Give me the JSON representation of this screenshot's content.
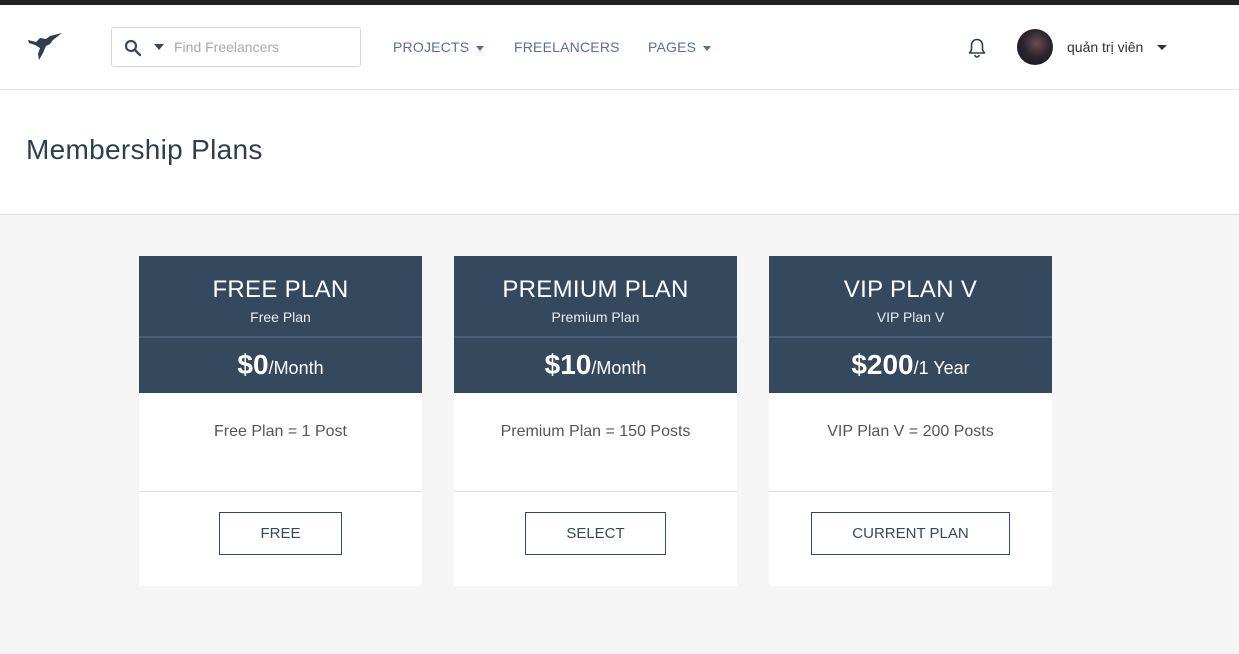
{
  "header": {
    "search_placeholder": "Find Freelancers",
    "nav": [
      {
        "label": "PROJECTS"
      },
      {
        "label": "FREELANCERS"
      },
      {
        "label": "PAGES"
      }
    ],
    "user_name": "quản trị viên"
  },
  "page": {
    "title": "Membership Plans"
  },
  "plans": [
    {
      "name": "FREE PLAN",
      "subtitle": "Free Plan",
      "amount": "$0",
      "period": "/Month",
      "description": "Free Plan = 1 Post",
      "button": "FREE"
    },
    {
      "name": "PREMIUM PLAN",
      "subtitle": "Premium Plan",
      "amount": "$10",
      "period": "/Month",
      "description": "Premium Plan = 150 Posts",
      "button": "SELECT"
    },
    {
      "name": "VIP PLAN V",
      "subtitle": "VIP Plan V",
      "amount": "$200",
      "period": "/1 Year",
      "description": "VIP Plan V = 200 Posts",
      "button": "CURRENT PLAN"
    }
  ],
  "colors": {
    "plan_header": "#34495e",
    "nav_link": "#5b6d9c",
    "page_bg": "#f5f5f5"
  },
  "icons": [
    "hummingbird-logo-icon",
    "search-icon",
    "chevron-down-icon",
    "bell-icon",
    "avatar"
  ]
}
